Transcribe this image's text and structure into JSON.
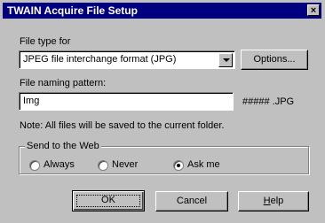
{
  "window": {
    "title": "TWAIN Acquire File Setup",
    "close_label": "×"
  },
  "file_type": {
    "label": "File type for",
    "selected": "JPEG file interchange format (JPG)",
    "options_button": "Options..."
  },
  "naming": {
    "label": "File naming pattern:",
    "value": "Img",
    "suffix": "##### .JPG"
  },
  "note": "Note: All files will be saved to the current folder.",
  "send_to_web": {
    "legend": "Send to the Web",
    "options": [
      {
        "label": "Always",
        "checked": false
      },
      {
        "label": "Never",
        "checked": false
      },
      {
        "label": "Ask me",
        "checked": true
      }
    ]
  },
  "buttons": {
    "ok": "OK",
    "cancel": "Cancel",
    "help_prefix": "H",
    "help_rest": "elp"
  }
}
